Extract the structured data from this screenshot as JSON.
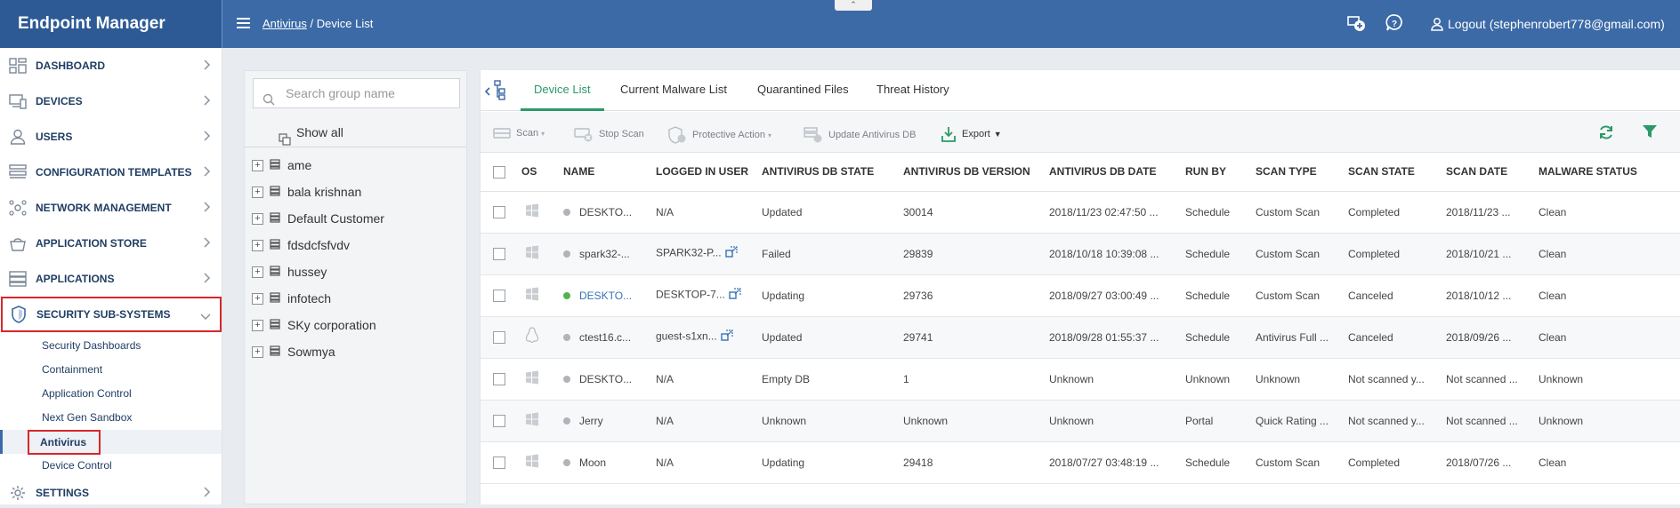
{
  "app": {
    "title": "Endpoint Manager"
  },
  "breadcrumb": {
    "parent": "Antivirus",
    "separator": "/",
    "current": "Device List"
  },
  "header": {
    "logout_label": "Logout (stephenrobert778@gmail.com)"
  },
  "sidebar": {
    "items": [
      {
        "label": "DASHBOARD",
        "icon": "dashboard-icon"
      },
      {
        "label": "DEVICES",
        "icon": "devices-icon"
      },
      {
        "label": "USERS",
        "icon": "users-icon"
      },
      {
        "label": "CONFIGURATION TEMPLATES",
        "icon": "templates-icon"
      },
      {
        "label": "NETWORK MANAGEMENT",
        "icon": "network-icon"
      },
      {
        "label": "APPLICATION STORE",
        "icon": "store-icon"
      },
      {
        "label": "APPLICATIONS",
        "icon": "applications-icon"
      },
      {
        "label": "SECURITY SUB-SYSTEMS",
        "icon": "shield-icon"
      }
    ],
    "sub_items": [
      {
        "label": "Security Dashboards"
      },
      {
        "label": "Containment"
      },
      {
        "label": "Application Control"
      },
      {
        "label": "Next Gen Sandbox"
      },
      {
        "label": "Antivirus"
      },
      {
        "label": "Device Control"
      }
    ],
    "settings_label": "SETTINGS"
  },
  "groups": {
    "search_placeholder": "Search group name",
    "show_all_label": "Show all",
    "items": [
      "ame",
      "bala krishnan",
      "Default Customer",
      "fdsdcfsfvdv",
      "hussey",
      "infotech",
      "SKy corporation",
      "Sowmya"
    ]
  },
  "tabs": [
    "Device List",
    "Current Malware List",
    "Quarantined Files",
    "Threat History"
  ],
  "toolbar": {
    "scan": "Scan",
    "stop_scan": "Stop Scan",
    "protective_action": "Protective Action",
    "update_db": "Update Antivirus DB",
    "export": "Export"
  },
  "table": {
    "columns": [
      "OS",
      "NAME",
      "LOGGED IN USER",
      "ANTIVIRUS DB STATE",
      "ANTIVIRUS DB VERSION",
      "ANTIVIRUS DB DATE",
      "RUN BY",
      "SCAN TYPE",
      "SCAN STATE",
      "SCAN DATE",
      "MALWARE STATUS"
    ],
    "rows": [
      {
        "os": "windows",
        "status": "offline",
        "name": "DESKTO...",
        "user": "N/A",
        "user_rdp": false,
        "db_state": "Updated",
        "db_version": "30014",
        "db_date": "2018/11/23 02:47:50 ...",
        "run_by": "Schedule",
        "scan_type": "Custom Scan",
        "scan_state": "Completed",
        "scan_date": "2018/11/23 ...",
        "malware": "Clean"
      },
      {
        "os": "windows",
        "status": "offline",
        "name": "spark32-...",
        "user": "SPARK32-P...",
        "user_rdp": true,
        "db_state": "Failed",
        "db_version": "29839",
        "db_date": "2018/10/18 10:39:08 ...",
        "run_by": "Schedule",
        "scan_type": "Custom Scan",
        "scan_state": "Completed",
        "scan_date": "2018/10/21 ...",
        "malware": "Clean"
      },
      {
        "os": "windows",
        "status": "online",
        "name": "DESKTO...",
        "user": "DESKTOP-7...",
        "user_rdp": true,
        "db_state": "Updating",
        "db_version": "29736",
        "db_date": "2018/09/27 03:00:49 ...",
        "run_by": "Schedule",
        "scan_type": "Custom Scan",
        "scan_state": "Canceled",
        "scan_date": "2018/10/12 ...",
        "malware": "Clean"
      },
      {
        "os": "linux",
        "status": "offline",
        "name": "ctest16.c...",
        "user": "guest-s1xn...",
        "user_rdp": true,
        "db_state": "Updated",
        "db_version": "29741",
        "db_date": "2018/09/28 01:55:37 ...",
        "run_by": "Schedule",
        "scan_type": "Antivirus Full ...",
        "scan_state": "Canceled",
        "scan_date": "2018/09/26 ...",
        "malware": "Clean"
      },
      {
        "os": "windows",
        "status": "offline",
        "name": "DESKTO...",
        "user": "N/A",
        "user_rdp": false,
        "db_state": "Empty DB",
        "db_version": "1",
        "db_date": "Unknown",
        "run_by": "Unknown",
        "scan_type": "Unknown",
        "scan_state": "Not scanned y...",
        "scan_date": "Not scanned ...",
        "malware": "Unknown"
      },
      {
        "os": "windows",
        "status": "offline",
        "name": "Jerry",
        "user": "N/A",
        "user_rdp": false,
        "db_state": "Unknown",
        "db_version": "Unknown",
        "db_date": "Unknown",
        "run_by": "Portal",
        "scan_type": "Quick Rating ...",
        "scan_state": "Not scanned y...",
        "scan_date": "Not scanned ...",
        "malware": "Unknown"
      },
      {
        "os": "windows",
        "status": "offline",
        "name": "Moon",
        "user": "N/A",
        "user_rdp": false,
        "db_state": "Updating",
        "db_version": "29418",
        "db_date": "2018/07/27 03:48:19 ...",
        "run_by": "Schedule",
        "scan_type": "Custom Scan",
        "scan_state": "Completed",
        "scan_date": "2018/07/26 ...",
        "malware": "Clean"
      }
    ]
  },
  "colors": {
    "header": "#3b6aa6",
    "brand": "#2d5a94",
    "accent_green": "#2a9a68",
    "highlight_red": "#d9262c",
    "online": "#52b44b"
  }
}
